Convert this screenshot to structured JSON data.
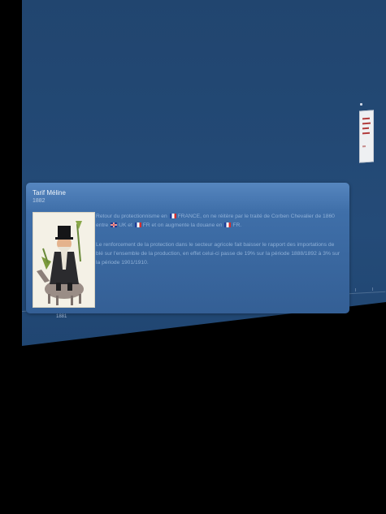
{
  "timeline": {
    "visible_year": "1881"
  },
  "popup": {
    "title": "Tarif Méline",
    "year": "1882",
    "image_icon": "caricature-illustration",
    "paragraph_1": {
      "part_a": "Retour du protectionnisme en ",
      "country_1": "FRANCE",
      "part_b": ", on ne réitère par le traité de Corben Chevalier de 1860 entre ",
      "country_2": "UK",
      "part_c": " et ",
      "country_3": "FR",
      "part_d": " et on augmente la douane en ",
      "country_4": "FR",
      "part_e": "."
    },
    "paragraph_2": "Le renforcement de la protection dans le secteur agricole fait baisser le rapport des importations de blé sur l'ensemble de la production, en effet celui-ci passe de 19% sur la période 1888/1892 à 3% sur la période 1901/1910."
  },
  "colors": {
    "background": "#000000",
    "panel": "#244b78",
    "popup": "#3f6fa9",
    "popup_text": "#8fb0d7",
    "title_text": "#eef4fb"
  }
}
